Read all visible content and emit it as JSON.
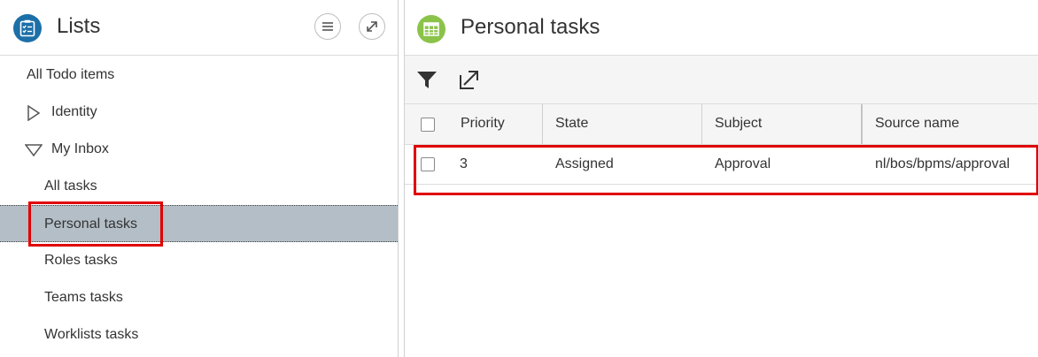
{
  "left_panel": {
    "title": "Lists",
    "icons": {
      "app": "clipboard-checklist-icon",
      "menu": "hamburger-menu-icon",
      "expand": "expand-arrow-icon"
    },
    "nav": {
      "all_todo": "All Todo items",
      "identity": "Identity",
      "my_inbox": "My Inbox",
      "all_tasks": "All tasks",
      "personal_tasks": "Personal tasks",
      "roles_tasks": "Roles tasks",
      "teams_tasks": "Teams tasks",
      "worklists_tasks": "Worklists tasks"
    },
    "selected": "Personal tasks"
  },
  "right_panel": {
    "title": "Personal tasks",
    "icons": {
      "header": "table-grid-icon",
      "filter": "filter-funnel-icon",
      "export": "export-arrow-icon"
    },
    "columns": [
      "Priority",
      "State",
      "Subject",
      "Source name"
    ],
    "rows": [
      {
        "priority": "3",
        "state": "Assigned",
        "subject": "Approval",
        "source_name": "nl/bos/bpms/approval"
      }
    ]
  },
  "colors": {
    "accent_blue": "#1d6fa8",
    "accent_green": "#8bc34a",
    "selected_row": "#b3bec6",
    "highlight_red": "#e00000"
  }
}
